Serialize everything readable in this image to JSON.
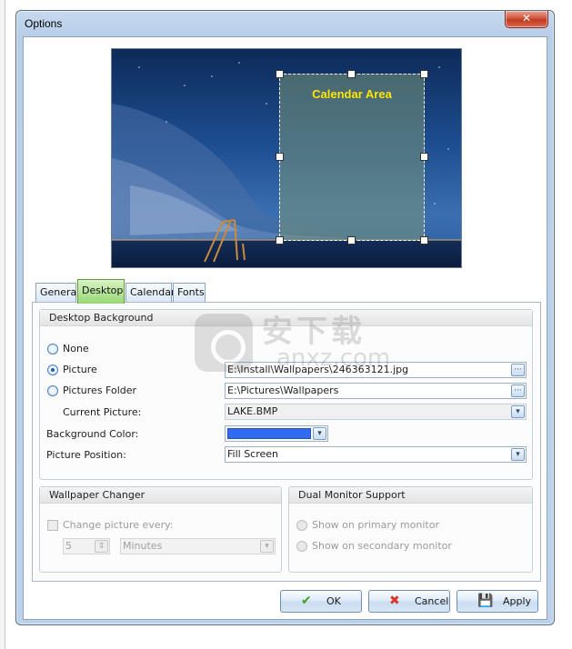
{
  "window": {
    "title": "Options",
    "close_glyph": "✕"
  },
  "preview": {
    "calendar_area_label": "Calendar Area"
  },
  "tabs": [
    {
      "label": "General",
      "active": false
    },
    {
      "label": "Desktop",
      "active": true
    },
    {
      "label": "Calendar",
      "active": false
    },
    {
      "label": "Fonts",
      "active": false
    }
  ],
  "desktop_background": {
    "header": "Desktop Background",
    "none_label": "None",
    "picture_label": "Picture",
    "picture_path": "E:\\Install\\Wallpapers\\246363121.jpg",
    "pictures_folder_label": "Pictures Folder",
    "pictures_folder_path": "E:\\Pictures\\Wallpapers",
    "current_picture_label": "Current Picture:",
    "current_picture_value": "LAKE.BMP",
    "background_color_label": "Background Color:",
    "background_color": "#2f6bf0",
    "picture_position_label": "Picture Position:",
    "picture_position_value": "Fill Screen",
    "browse_glyph": "···",
    "dropdown_glyph": "▾"
  },
  "wallpaper_changer": {
    "header": "Wallpaper Changer",
    "change_label": "Change picture every:",
    "interval_value": "5",
    "unit_value": "Minutes",
    "spin_glyph": "⇕"
  },
  "dual_monitor": {
    "header": "Dual Monitor Support",
    "primary_label": "Show on primary monitor",
    "secondary_label": "Show on secondary monitor"
  },
  "buttons": {
    "ok_label": "OK",
    "ok_icon": "✔",
    "cancel_label": "Cancel",
    "cancel_icon": "✖",
    "apply_label": "Apply",
    "apply_icon": "💾"
  },
  "watermark": {
    "cn": "安下载",
    "en": "anxz.com"
  }
}
